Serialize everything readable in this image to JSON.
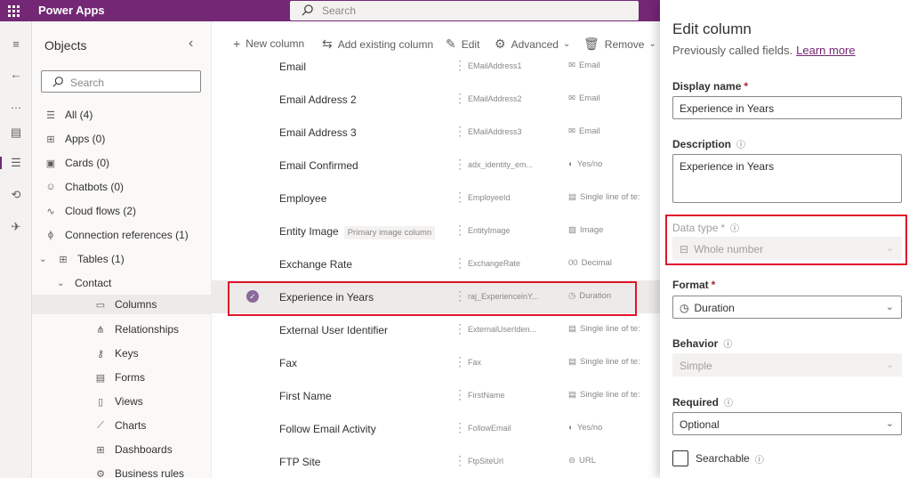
{
  "app": {
    "title": "Power Apps"
  },
  "topsearch": {
    "placeholder": "Search"
  },
  "objects": {
    "title": "Objects",
    "search_placeholder": "Search",
    "items": [
      {
        "label": "All (4)",
        "icon": "list-icon"
      },
      {
        "label": "Apps (0)",
        "icon": "apps-icon"
      },
      {
        "label": "Cards (0)",
        "icon": "card-icon"
      },
      {
        "label": "Chatbots (0)",
        "icon": "chatbot-icon"
      },
      {
        "label": "Cloud flows (2)",
        "icon": "flow-icon"
      },
      {
        "label": "Connection references (1)",
        "icon": "connection-icon"
      },
      {
        "label": "Tables (1)",
        "icon": "table-icon"
      },
      {
        "label": "Contact"
      },
      {
        "label": "Columns",
        "icon": "columns-icon"
      },
      {
        "label": "Relationships",
        "icon": "relationships-icon"
      },
      {
        "label": "Keys",
        "icon": "key-icon"
      },
      {
        "label": "Forms",
        "icon": "form-icon"
      },
      {
        "label": "Views",
        "icon": "view-icon"
      },
      {
        "label": "Charts",
        "icon": "chart-icon"
      },
      {
        "label": "Dashboards",
        "icon": "dashboard-icon"
      },
      {
        "label": "Business rules",
        "icon": "business-rule-icon"
      }
    ]
  },
  "commands": {
    "new_column": "New column",
    "add_existing": "Add existing column",
    "edit": "Edit",
    "advanced": "Advanced",
    "remove": "Remove"
  },
  "rows": [
    {
      "name": "Email",
      "schema": "EMailAddress1",
      "type": "Email",
      "ticon": "✉"
    },
    {
      "name": "Email Address 2",
      "schema": "EMailAddress2",
      "type": "Email",
      "ticon": "✉"
    },
    {
      "name": "Email Address 3",
      "schema": "EMailAddress3",
      "type": "Email",
      "ticon": "✉"
    },
    {
      "name": "Email Confirmed",
      "schema": "adx_identity_em...",
      "type": "Yes/no",
      "ticon": "◐"
    },
    {
      "name": "Employee",
      "schema": "EmployeeId",
      "type": "Single line of te:",
      "ticon": "▤"
    },
    {
      "name": "Entity Image",
      "tag": "Primary image column",
      "schema": "EntityImage",
      "type": "Image",
      "ticon": "▨"
    },
    {
      "name": "Exchange Rate",
      "schema": "ExchangeRate",
      "type": "Decimal",
      "ticon": "00"
    },
    {
      "name": "Experience in Years",
      "schema": "raj_ExperienceinY...",
      "type": "Duration",
      "ticon": "◷",
      "selected": true
    },
    {
      "name": "External User Identifier",
      "schema": "ExternalUserIden...",
      "type": "Single line of te:",
      "ticon": "▤"
    },
    {
      "name": "Fax",
      "schema": "Fax",
      "type": "Single line of te:",
      "ticon": "▤"
    },
    {
      "name": "First Name",
      "schema": "FirstName",
      "type": "Single line of te:",
      "ticon": "▤"
    },
    {
      "name": "Follow Email Activity",
      "schema": "FollowEmail",
      "type": "Yes/no",
      "ticon": "◐"
    },
    {
      "name": "FTP Site",
      "schema": "FtpSiteUrl",
      "type": "URL",
      "ticon": "⊖"
    }
  ],
  "panel": {
    "title": "Edit column",
    "subtitle": "Previously called fields.",
    "learn_more": "Learn more",
    "display_name_label": "Display name",
    "display_name_value": "Experience in Years",
    "description_label": "Description",
    "description_value": "Experience in Years",
    "data_type_label": "Data type",
    "data_type_value": "Whole number",
    "format_label": "Format",
    "format_value": "Duration",
    "behavior_label": "Behavior",
    "behavior_value": "Simple",
    "required_label": "Required",
    "required_value": "Optional",
    "searchable_label": "Searchable",
    "required_marker": "*",
    "info_glyph": "ⓘ"
  },
  "colors": {
    "brand": "#742774",
    "highlight": "#e0162b"
  }
}
